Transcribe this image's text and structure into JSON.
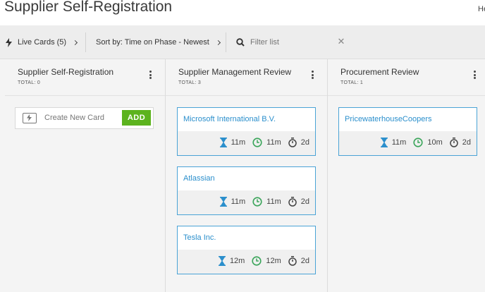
{
  "header": {
    "title": "Supplier Self-Registration",
    "right_text": "He"
  },
  "toolbar": {
    "live_cards": "Live Cards (5)",
    "sort": "Sort by: Time on Phase - Newest",
    "filter_placeholder": "Filter list"
  },
  "columns": [
    {
      "title": "Supplier Self-Registration",
      "total": "TOTAL: 0",
      "new_card_label": "Create New Card",
      "add_label": "ADD"
    },
    {
      "title": "Supplier Management Review",
      "total": "TOTAL: 3",
      "cards": [
        {
          "name": "Microsoft International B.V.",
          "hourglass": "11m",
          "clock": "11m",
          "timer": "2d"
        },
        {
          "name": "Atlassian",
          "hourglass": "11m",
          "clock": "11m",
          "timer": "2d"
        },
        {
          "name": "Tesla Inc.",
          "hourglass": "12m",
          "clock": "12m",
          "timer": "2d"
        }
      ]
    },
    {
      "title": "Procurement Review",
      "total": "TOTAL: 1",
      "cards": [
        {
          "name": "PricewaterhouseCoopers",
          "hourglass": "11m",
          "clock": "10m",
          "timer": "2d"
        }
      ]
    }
  ],
  "colors": {
    "accent_blue": "#2b8fcc",
    "card_border": "#4aa3d6",
    "add_green": "#5cb31e",
    "clock_green": "#3aa55a"
  },
  "icons": [
    "lightning-icon",
    "chevron-right-icon",
    "search-icon",
    "close-icon",
    "more-vertical-icon",
    "card-icon",
    "hourglass-icon",
    "clock-icon",
    "stopwatch-icon"
  ]
}
